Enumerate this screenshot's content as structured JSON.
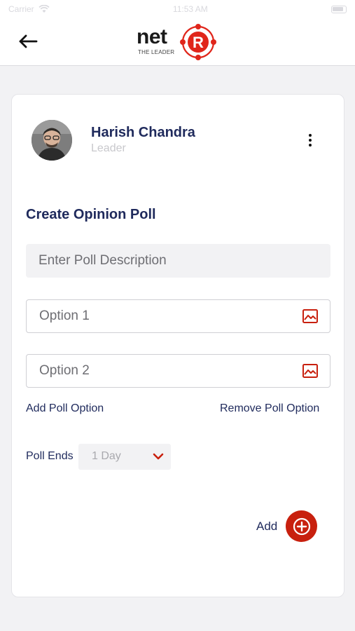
{
  "status_bar": {
    "carrier": "Carrier",
    "time": "11:53 AM"
  },
  "header": {
    "back_icon": "arrow-left-icon",
    "logo": {
      "wordmark": "net",
      "mark_letter": "R",
      "tagline": "THE LEADER"
    }
  },
  "profile": {
    "name": "Harish Chandra",
    "role": "Leader",
    "menu_icon": "kebab-menu-icon"
  },
  "poll": {
    "title": "Create Opinion Poll",
    "description_placeholder": "Enter Poll Description",
    "options": [
      {
        "placeholder": "Option 1",
        "icon": "image-icon"
      },
      {
        "placeholder": "Option 2",
        "icon": "image-icon"
      }
    ],
    "add_option_label": "Add Poll Option",
    "remove_option_label": "Remove Poll Option",
    "ends_label": "Poll Ends",
    "ends_value": "1 Day",
    "add_label": "Add"
  },
  "colors": {
    "accent": "#c8200e",
    "text_primary": "#1f2a5c",
    "muted": "#c8c8cc",
    "background": "#f2f2f4"
  }
}
